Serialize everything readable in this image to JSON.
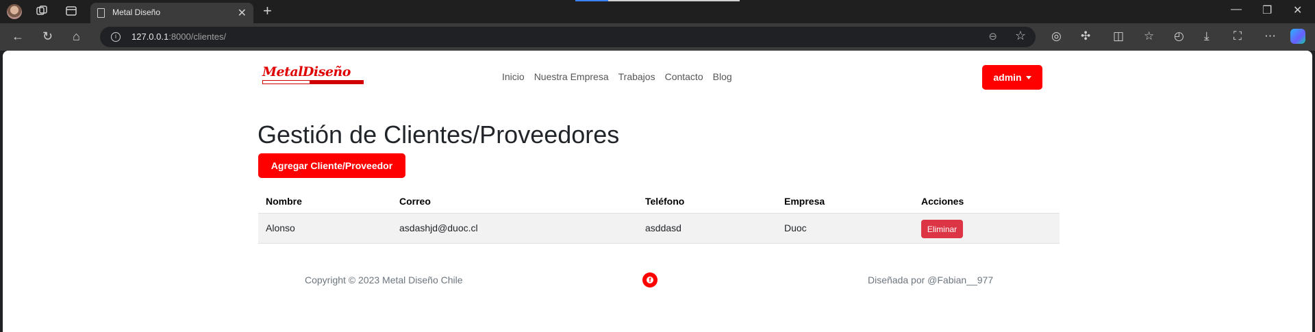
{
  "browser": {
    "tab_title": "Metal Diseño",
    "url_host": "127.0.0.1",
    "url_path": ":8000/clientes/"
  },
  "site": {
    "logo_text": "MetalDiseño",
    "nav": [
      "Inicio",
      "Nuestra Empresa",
      "Trabajos",
      "Contacto",
      "Blog"
    ],
    "user_menu_label": "admin"
  },
  "main": {
    "title": "Gestión de Clientes/Proveedores",
    "add_button": "Agregar Cliente/Proveedor",
    "table": {
      "headers": [
        "Nombre",
        "Correo",
        "Teléfono",
        "Empresa",
        "Acciones"
      ],
      "rows": [
        {
          "nombre": "Alonso",
          "correo": "asdashjd@duoc.cl",
          "telefono": "asddasd",
          "empresa": "Duoc",
          "accion": "Eliminar"
        }
      ]
    }
  },
  "footer": {
    "copyright": "Copyright © 2023 Metal Diseño Chile",
    "credit": "Diseñada por @Fabian__977"
  },
  "colors": {
    "brand_red": "#ff0000",
    "danger": "#dc3545"
  }
}
